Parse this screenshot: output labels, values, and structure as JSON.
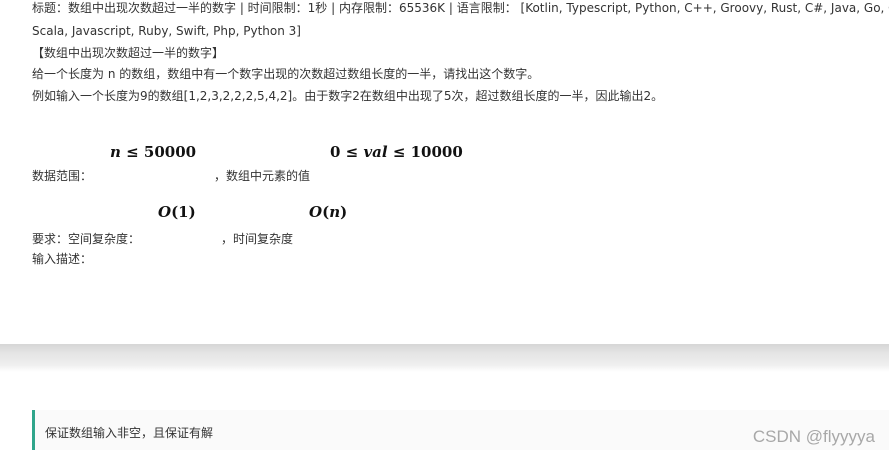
{
  "problem": {
    "title_line1": "标题：数组中出现次数超过一半的数字 | 时间限制：1秒 | 内存限制：65536K | 语言限制： [Kotlin, Typescript, Python, C++, Groovy, Rust, C#, Java, Go, C,",
    "title_line2": "Scala, Javascript, Ruby, Swift, Php, Python 3]",
    "heading": "【数组中出现次数超过一半的数字】",
    "description_1": "给一个长度为 n 的数组，数组中有一个数字出现的次数超过数组长度的一半，请找出这个数字。",
    "description_2": "例如输入一个长度为9的数组[1,2,3,2,2,2,5,4,2]。由于数字2在数组中出现了5次，超过数组长度的一半，因此输出2。"
  },
  "range": {
    "label": "数据范围：",
    "suffix": "，数组中元素的值",
    "math_n_var": "n",
    "math_n_rest": " ≤ 50000",
    "math_val_prefix": "0 ≤ ",
    "math_val_var": "val",
    "math_val_rest": " ≤ 10000"
  },
  "requirement": {
    "label": "要求：空间复杂度：",
    "suffix": "，时间复杂度",
    "space_var": "O",
    "space_rest": "(1)",
    "time_var": "O",
    "time_rest_open": "(",
    "time_rest_var": "n",
    "time_rest_close": ")"
  },
  "input_desc": "输入描述：",
  "note": "保证数组输入非空，且保证有解",
  "watermark": "CSDN @flyyyya",
  "colors": {
    "accent_border": "#2fa58b",
    "text": "#333333",
    "watermark": "#a8a8a8"
  }
}
